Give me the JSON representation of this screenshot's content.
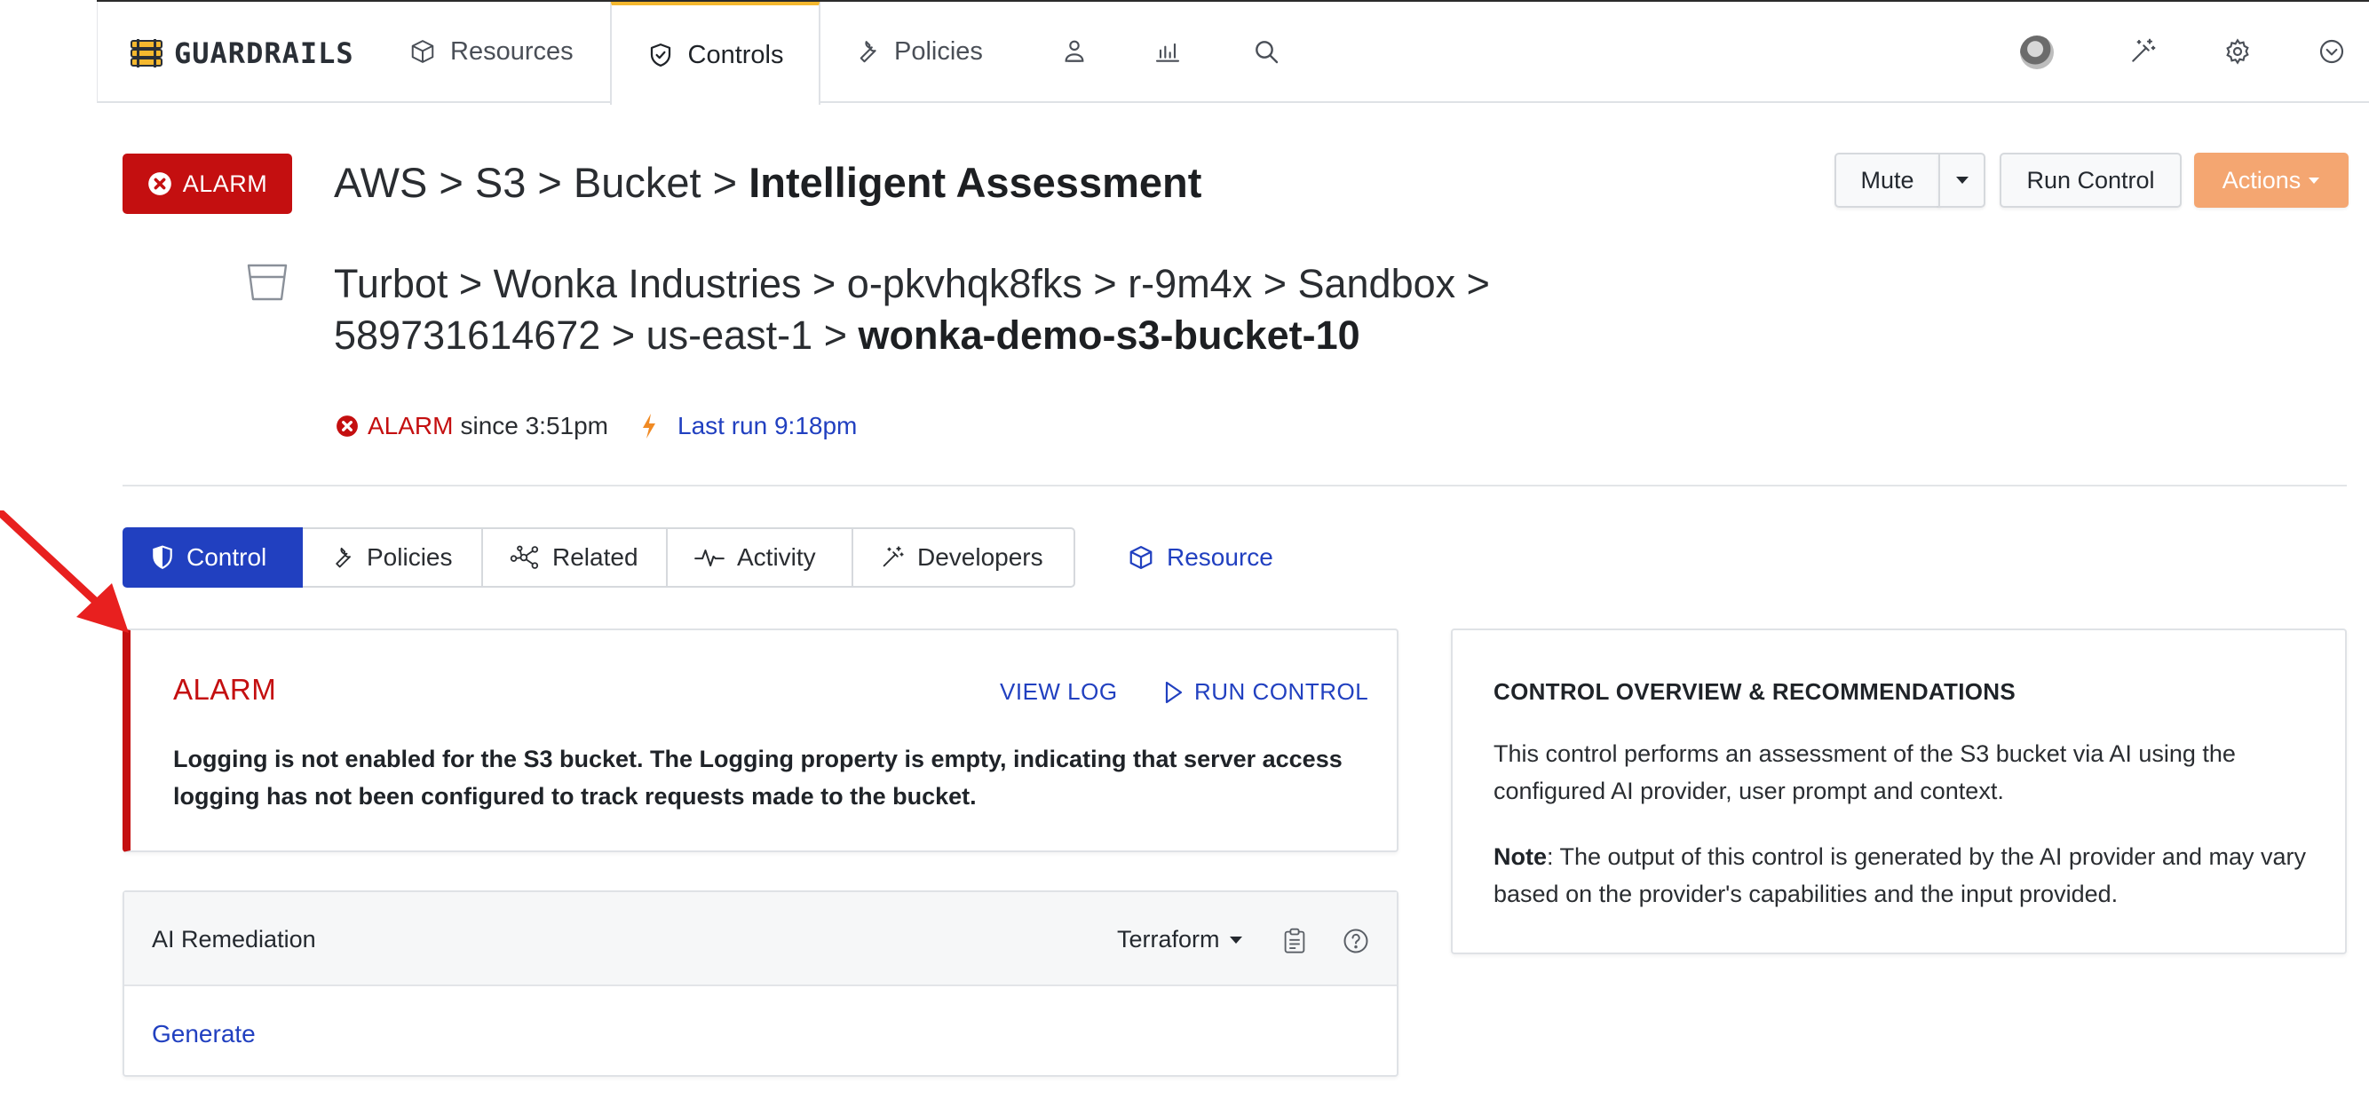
{
  "brand": {
    "name": "GUARDRAILS"
  },
  "topnav": {
    "tabs": [
      {
        "label": "Resources",
        "icon": "cube-icon"
      },
      {
        "label": "Controls",
        "icon": "shield-icon",
        "active": true
      },
      {
        "label": "Policies",
        "icon": "wrench-icon"
      }
    ],
    "icon_only": [
      "person-icon",
      "bar-chart-icon",
      "search-icon"
    ],
    "right_icons": [
      "avatar",
      "magic-wand-icon",
      "gear-icon",
      "chevron-down-circle-icon"
    ]
  },
  "header": {
    "alarm_badge": "ALARM",
    "breadcrumb": "AWS > S3 > Bucket > ",
    "breadcrumb_current": "Intelligent Assessment",
    "buttons": {
      "mute": "Mute",
      "run_control": "Run Control",
      "actions": "Actions"
    }
  },
  "resource_path": {
    "line1": "Turbot > Wonka Industries > o-pkvhqk8fks > r-9m4x > Sandbox >",
    "line2_prefix": "589731614672 > us-east-1 > ",
    "line2_name": "wonka-demo-s3-bucket-10"
  },
  "status": {
    "state": "ALARM",
    "since": "since 3:51pm",
    "last_run": "Last run 9:18pm"
  },
  "subtabs": [
    {
      "label": "Control",
      "icon": "shield-half-icon",
      "active": true
    },
    {
      "label": "Policies",
      "icon": "wrench-icon"
    },
    {
      "label": "Related",
      "icon": "graph-nodes-icon"
    },
    {
      "label": "Activity",
      "icon": "pulse-icon"
    },
    {
      "label": "Developers",
      "icon": "magic-wand-icon"
    }
  ],
  "resource_link": "Resource",
  "alarm_panel": {
    "title": "ALARM",
    "view_log": "VIEW LOG",
    "run_control": "RUN CONTROL",
    "message": "Logging is not enabled for the S3 bucket. The Logging property is empty, indicating that server access logging has not been configured to track requests made to the bucket."
  },
  "ai_remediation": {
    "title": "AI Remediation",
    "format": "Terraform",
    "generate": "Generate"
  },
  "overview": {
    "title": "CONTROL OVERVIEW & RECOMMENDATIONS",
    "description": "This control performs an assessment of the S3 bucket via AI using the configured AI provider, user prompt and context.",
    "note_label": "Note",
    "note_text": ": The output of this control is generated by the AI provider and may vary based on the provider's capabilities and the input provided."
  },
  "colors": {
    "alarm": "#c40f10",
    "primary": "#2140c0",
    "accent_tab": "#f5b82e",
    "actions_button": "#f4a671",
    "annotation_arrow": "#e8201f"
  }
}
